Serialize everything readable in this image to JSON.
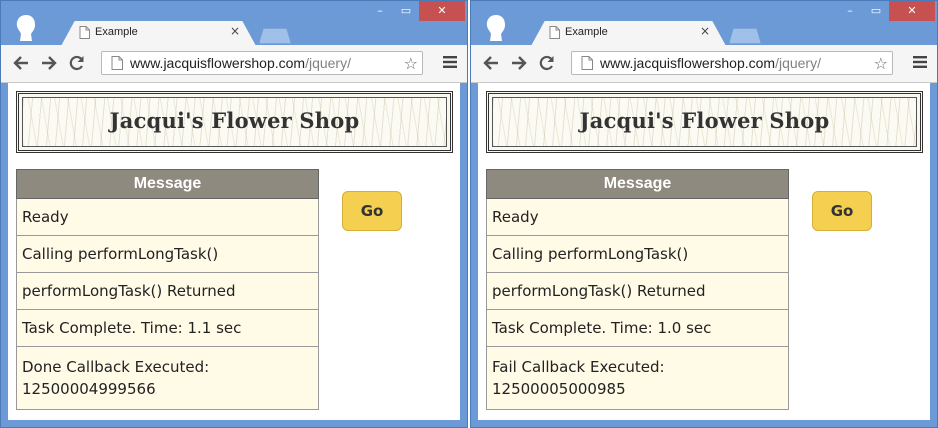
{
  "windows": [
    {
      "tab": {
        "title": "Example",
        "close": "×"
      },
      "controls": {
        "minimize": "–",
        "maximize": "▭",
        "close": "✕"
      },
      "url": {
        "host": "www.jacquisflowershop.com",
        "path": "/jquery/"
      },
      "banner_title": "Jacqui's Flower Shop",
      "table": {
        "header": "Message",
        "rows": [
          "Ready",
          "Calling performLongTask()",
          "performLongTask() Returned",
          "Task Complete. Time: 1.1 sec",
          "Done Callback Executed: 12500004999566"
        ]
      },
      "go_label": "Go"
    },
    {
      "tab": {
        "title": "Example",
        "close": "×"
      },
      "controls": {
        "minimize": "–",
        "maximize": "▭",
        "close": "✕"
      },
      "url": {
        "host": "www.jacquisflowershop.com",
        "path": "/jquery/"
      },
      "banner_title": "Jacqui's Flower Shop",
      "table": {
        "header": "Message",
        "rows": [
          "Ready",
          "Calling performLongTask()",
          "performLongTask() Returned",
          "Task Complete. Time: 1.0 sec",
          "Fail Callback Executed: 12500005000985"
        ]
      },
      "go_label": "Go"
    }
  ],
  "icons": {
    "back": "back-arrow-icon",
    "forward": "forward-arrow-icon",
    "reload": "reload-icon",
    "star": "bookmark-star-icon",
    "menu": "hamburger-menu-icon",
    "page": "page-icon",
    "profile": "profile-icon"
  },
  "colors": {
    "frame": "#6b9ad6",
    "header_bg": "#8f8a80",
    "row_bg": "#fffbe7",
    "button_bg": "#f5cf4f",
    "close_btn": "#c75050"
  }
}
